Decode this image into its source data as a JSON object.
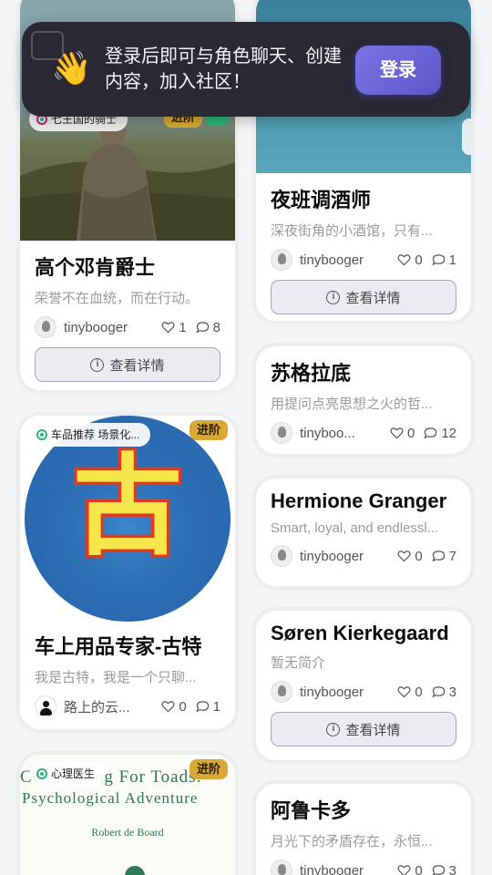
{
  "banner": {
    "message": "登录后即可与角色聊天、创建内容，加入社区！",
    "login_label": "登录"
  },
  "common": {
    "detail_label": "查看详情",
    "info_icon": "i"
  },
  "left": [
    {
      "tag": "七王国的骑士",
      "badge": "进阶",
      "title": "高个邓肯爵士",
      "desc": "荣誉不在血统，而在行动。",
      "author": "tinybooger",
      "likes": "1",
      "comments": "8"
    },
    {
      "tag": "车品推荐 场景化...",
      "badge": "进阶",
      "title": "车上用品专家-古特",
      "desc": "我是古特，我是一个只聊...",
      "author": "路上的云...",
      "likes": "0",
      "comments": "1",
      "logo_char": "古"
    },
    {
      "tag": "心理医生",
      "badge": "进阶",
      "book_line1": "Counselling For Toads:",
      "book_line2": "Psychological Adventure",
      "book_author": "Robert de Board"
    }
  ],
  "right": [
    {
      "title": "夜班调酒师",
      "desc": "深夜街角的小酒馆，只有...",
      "author": "tinybooger",
      "likes": "0",
      "comments": "1"
    },
    {
      "title": "苏格拉底",
      "desc": "用提问点亮思想之火的哲...",
      "author": "tinyboo...",
      "likes": "0",
      "comments": "12"
    },
    {
      "title": "Hermione Granger",
      "desc": "Smart, loyal, and endlessl...",
      "author": "tinybooger",
      "likes": "0",
      "comments": "7"
    },
    {
      "title": "Søren Kierkegaard",
      "desc": "暂无简介",
      "author": "tinybooger",
      "likes": "0",
      "comments": "3"
    },
    {
      "title": "阿鲁卡多",
      "desc": "月光下的矛盾存在，永恒...",
      "author": "tinybooger",
      "likes": "0",
      "comments": "3"
    }
  ]
}
